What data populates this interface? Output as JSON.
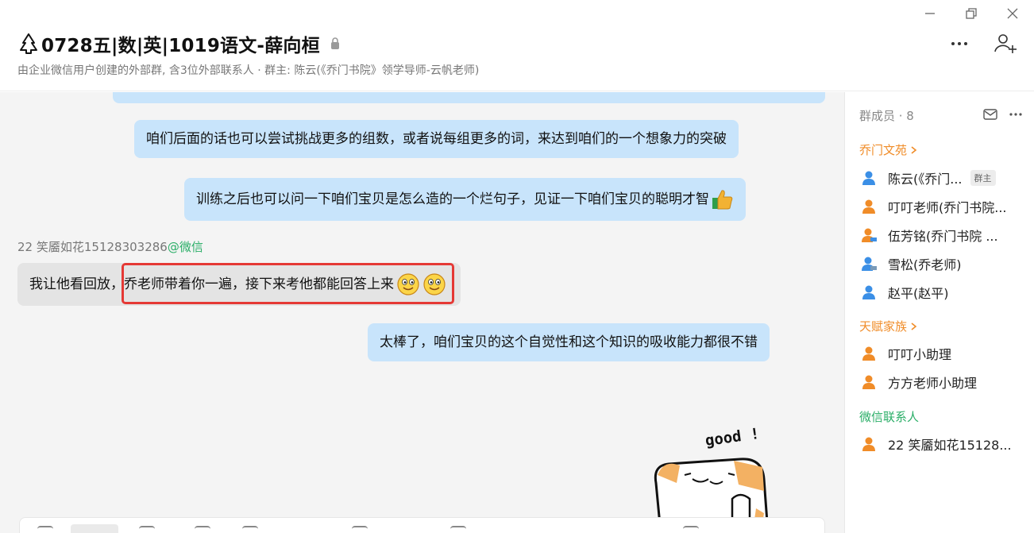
{
  "header": {
    "title": "0728五|数|英|1019语文-薛向桓",
    "subtitle": "由企业微信用户创建的外部群, 含3位外部联系人 · 群主: 陈云(《乔门书院》领学导师-云帆老师)"
  },
  "messages": [
    {
      "text": "咱们后面的话也可以尝试挑战更多的组数，或者说每组更多的词，来达到咱们的一个想象力的突破"
    },
    {
      "text": "训练之后也可以问一下咱们宝贝是怎么造的一个烂句子，见证一下咱们宝贝的聪明才智"
    },
    {
      "sender": "22 笑靥如花15128303286",
      "sender_tag": "@微信",
      "text": "我让他看回放，乔老师带着你一遍，接下来考他都能回答上来"
    },
    {
      "text": "太棒了，咱们宝贝的这个自觉性和这个知识的吸收能力都很不错"
    }
  ],
  "sticker": {
    "text": "good !"
  },
  "sidebar": {
    "title": "群成员 · 8",
    "groups": [
      {
        "name": "乔门文苑",
        "members": [
          {
            "name": "陈云(《乔门...",
            "badge": "群主"
          },
          {
            "name": "叮叮老师(乔门书院..."
          },
          {
            "name": "伍芳铭(乔门书院 ..."
          },
          {
            "name": "雪松(乔老师)"
          },
          {
            "name": "赵平(赵平)"
          }
        ]
      },
      {
        "name": "天赋家族",
        "members": [
          {
            "name": "叮叮小助理"
          },
          {
            "name": "方方老师小助理"
          }
        ]
      },
      {
        "name": "微信联系人",
        "members": [
          {
            "name": "22 笑靥如花15128..."
          }
        ]
      }
    ]
  },
  "colors": {
    "accent_orange": "#f08c28",
    "wechat_green": "#2aae67",
    "my_bubble": "#c8e4fb",
    "highlight_red": "#e53935"
  }
}
